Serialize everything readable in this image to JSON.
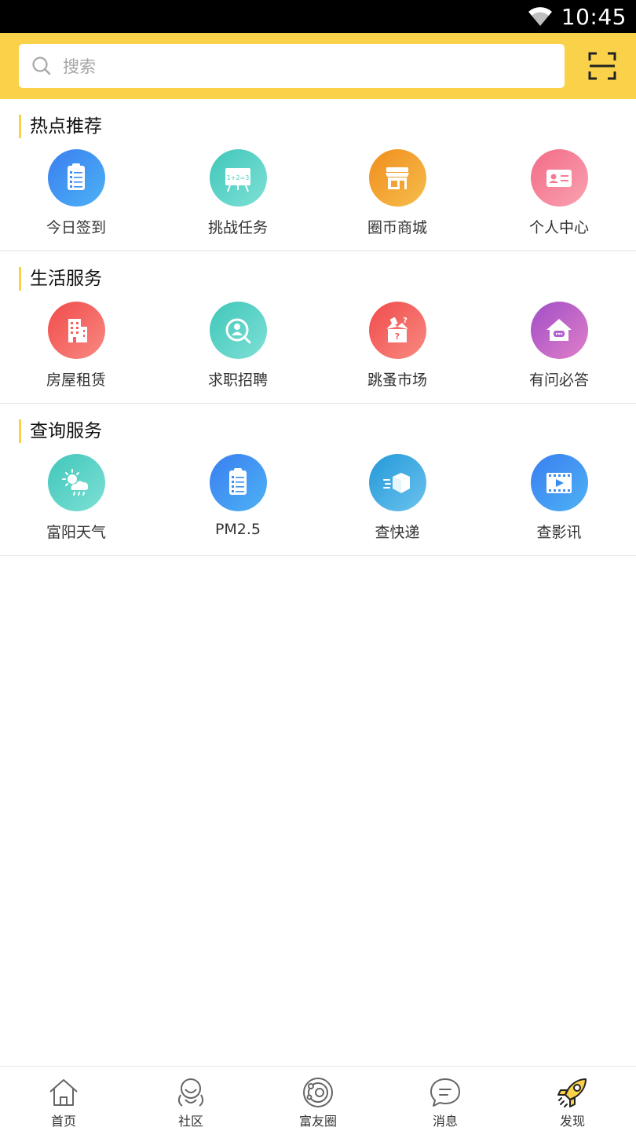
{
  "status_bar": {
    "time": "10:45",
    "wifi_icon": "wifi-icon"
  },
  "header": {
    "search_placeholder": "搜索",
    "search_icon": "search-icon",
    "scan_icon": "scan-icon",
    "accent_color": "#f9d249"
  },
  "sections": [
    {
      "title": "热点推荐",
      "items": [
        {
          "label": "今日签到",
          "icon": "clipboard-checklist-icon",
          "color": "#3a8ef0"
        },
        {
          "label": "挑战任务",
          "icon": "whiteboard-icon",
          "color": "#4fcfc2"
        },
        {
          "label": "圈币商城",
          "icon": "store-icon",
          "color": "#f3a233"
        },
        {
          "label": "个人中心",
          "icon": "id-card-icon",
          "color": "#f47c95"
        }
      ]
    },
    {
      "title": "生活服务",
      "items": [
        {
          "label": "房屋租赁",
          "icon": "building-icon",
          "color": "#f26060"
        },
        {
          "label": "求职招聘",
          "icon": "person-search-icon",
          "color": "#4fcfc2"
        },
        {
          "label": "跳蚤市场",
          "icon": "mystery-box-icon",
          "color": "#f26060"
        },
        {
          "label": "有问必答",
          "icon": "house-chat-icon",
          "color": "#b05fcf"
        }
      ]
    },
    {
      "title": "查询服务",
      "items": [
        {
          "label": "富阳天气",
          "icon": "weather-icon",
          "color": "#4fcfc2"
        },
        {
          "label": "PM2.5",
          "icon": "clipboard-checklist-icon",
          "color": "#3a8ef0"
        },
        {
          "label": "查快递",
          "icon": "package-icon",
          "color": "#3a9ee0"
        },
        {
          "label": "查影讯",
          "icon": "film-icon",
          "color": "#3a8ef0"
        }
      ]
    }
  ],
  "bottom_nav": {
    "items": [
      {
        "label": "首页",
        "icon": "home-icon"
      },
      {
        "label": "社区",
        "icon": "community-icon"
      },
      {
        "label": "富友圈",
        "icon": "circle-icon"
      },
      {
        "label": "消息",
        "icon": "message-icon"
      },
      {
        "label": "发现",
        "icon": "rocket-icon",
        "active": true
      }
    ]
  }
}
